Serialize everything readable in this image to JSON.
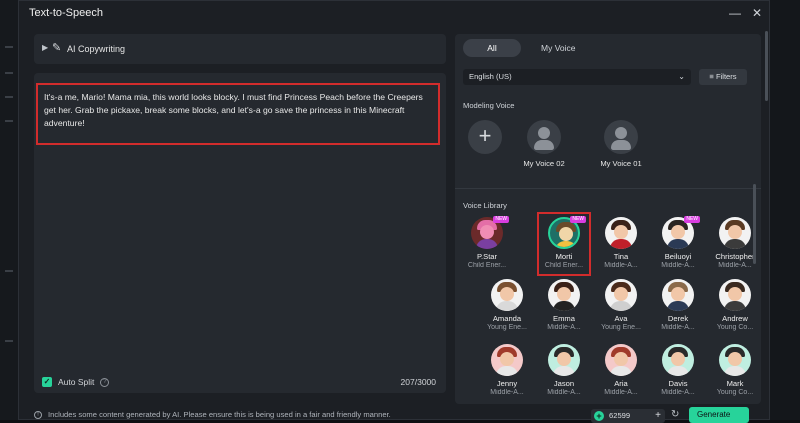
{
  "window": {
    "title": "Text-to-Speech",
    "minimize_icon": "minimize-icon",
    "close_icon": "close-icon"
  },
  "left": {
    "ai_copywriting_label": "AI Copywriting",
    "script_text": "It's-a me, Mario! Mama mia, this world looks blocky. I must find Princess Peach before the Creepers get her. Grab the pickaxe, break some blocks, and let's-a go save the princess in this Minecraft adventure!",
    "auto_split_label": "Auto Split",
    "char_count": "207/3000"
  },
  "footer": {
    "notice": "Includes some content generated by AI. Please ensure this is being used in a fair and friendly manner.",
    "credits": "62599",
    "generate_label": "Generate"
  },
  "right": {
    "tabs": [
      {
        "label": "All",
        "active": true
      },
      {
        "label": "My Voice",
        "active": false
      }
    ],
    "language": "English (US)",
    "filters_label": "Filters",
    "modeling_title": "Modeling Voice",
    "modeling": [
      {
        "label": "My Voice 02"
      },
      {
        "label": "My Voice 01"
      }
    ],
    "library_title": "Voice Library",
    "badge_text": "NEW",
    "voices": [
      {
        "name": "P.Star",
        "type": "Child Ener..."
      },
      {
        "name": "Morti",
        "type": "Child Ener..."
      },
      {
        "name": "Tina",
        "type": "Middle-A..."
      },
      {
        "name": "Beiluoyi",
        "type": "Middle-A..."
      },
      {
        "name": "Christopher",
        "type": "Middle-A..."
      },
      {
        "name": "Amanda",
        "type": "Young Ene..."
      },
      {
        "name": "Emma",
        "type": "Middle-A..."
      },
      {
        "name": "Ava",
        "type": "Young Ene..."
      },
      {
        "name": "Derek",
        "type": "Middle-A..."
      },
      {
        "name": "Andrew",
        "type": "Young Co..."
      },
      {
        "name": "Jenny",
        "type": "Middle-A..."
      },
      {
        "name": "Jason",
        "type": "Middle-A..."
      },
      {
        "name": "Aria",
        "type": "Middle-A..."
      },
      {
        "name": "Davis",
        "type": "Middle-A..."
      },
      {
        "name": "Mark",
        "type": "Young Co..."
      }
    ]
  },
  "colors": {
    "accent": "#27d39a",
    "highlight": "#d22c2c",
    "badge": "#d93de0"
  }
}
